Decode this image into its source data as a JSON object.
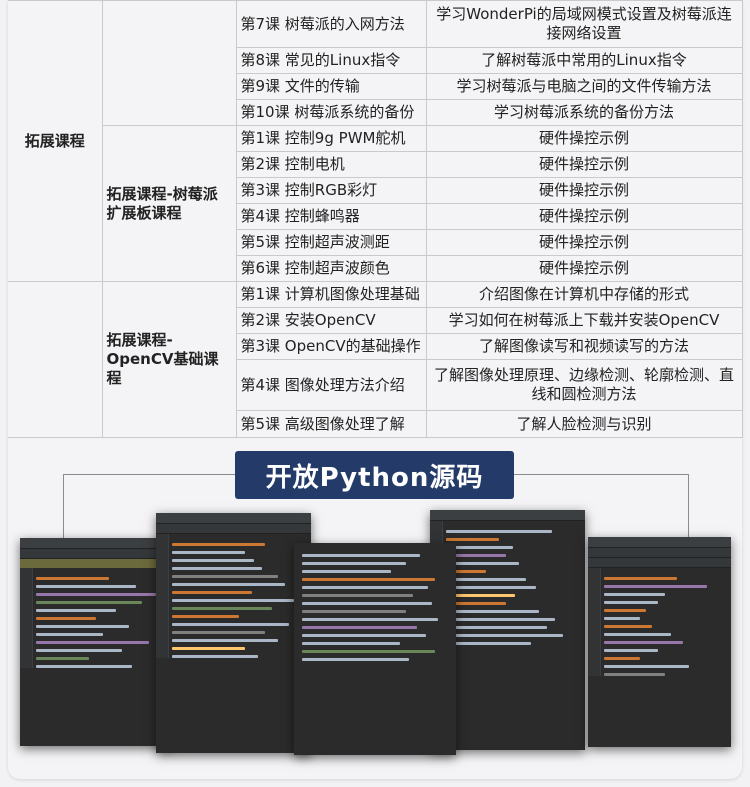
{
  "sections": [
    {
      "major": "拓展课程",
      "rows": [
        {
          "lesson": "第7课 树莓派的入网方法",
          "desc": "学习WonderPi的局域网模式设置及树莓派连接网络设置"
        },
        {
          "lesson": "第8课 常见的Linux指令",
          "desc": "了解树莓派中常用的Linux指令"
        },
        {
          "lesson": "第9课 文件的传输",
          "desc": "学习树莓派与电脑之间的文件传输方法"
        },
        {
          "lesson": "第10课 树莓派系统的备份",
          "desc": "学习树莓派系统的备份方法"
        }
      ]
    },
    {
      "sub": "拓展课程-树莓派扩展板课程",
      "rows": [
        {
          "lesson": "第1课 控制9g PWM舵机",
          "desc": "硬件操控示例"
        },
        {
          "lesson": "第2课 控制电机",
          "desc": "硬件操控示例"
        },
        {
          "lesson": "第3课 控制RGB彩灯",
          "desc": "硬件操控示例"
        },
        {
          "lesson": "第4课 控制蜂鸣器",
          "desc": "硬件操控示例"
        },
        {
          "lesson": "第5课 控制超声波测距",
          "desc": "硬件操控示例"
        },
        {
          "lesson": "第6课 控制超声波颜色",
          "desc": "硬件操控示例"
        }
      ]
    },
    {
      "sub": "拓展课程-OpenCV基础课程",
      "rows": [
        {
          "lesson": "第1课 计算机图像处理基础",
          "desc": "介绍图像在计算机中存储的形式"
        },
        {
          "lesson": "第2课 安装OpenCV",
          "desc": "学习如何在树莓派上下载并安装OpenCV"
        },
        {
          "lesson": "第3课 OpenCV的基础操作",
          "desc": "了解图像读写和视频读写的方法"
        },
        {
          "lesson": "第4课 图像处理方法介绍",
          "desc": "了解图像处理原理、边缘检测、轮廓检测、直线和圆检测方法"
        },
        {
          "lesson": "第5课 高级图像处理了解",
          "desc": "了解人脸检测与识别"
        }
      ]
    }
  ],
  "banner": "开放Python源码"
}
